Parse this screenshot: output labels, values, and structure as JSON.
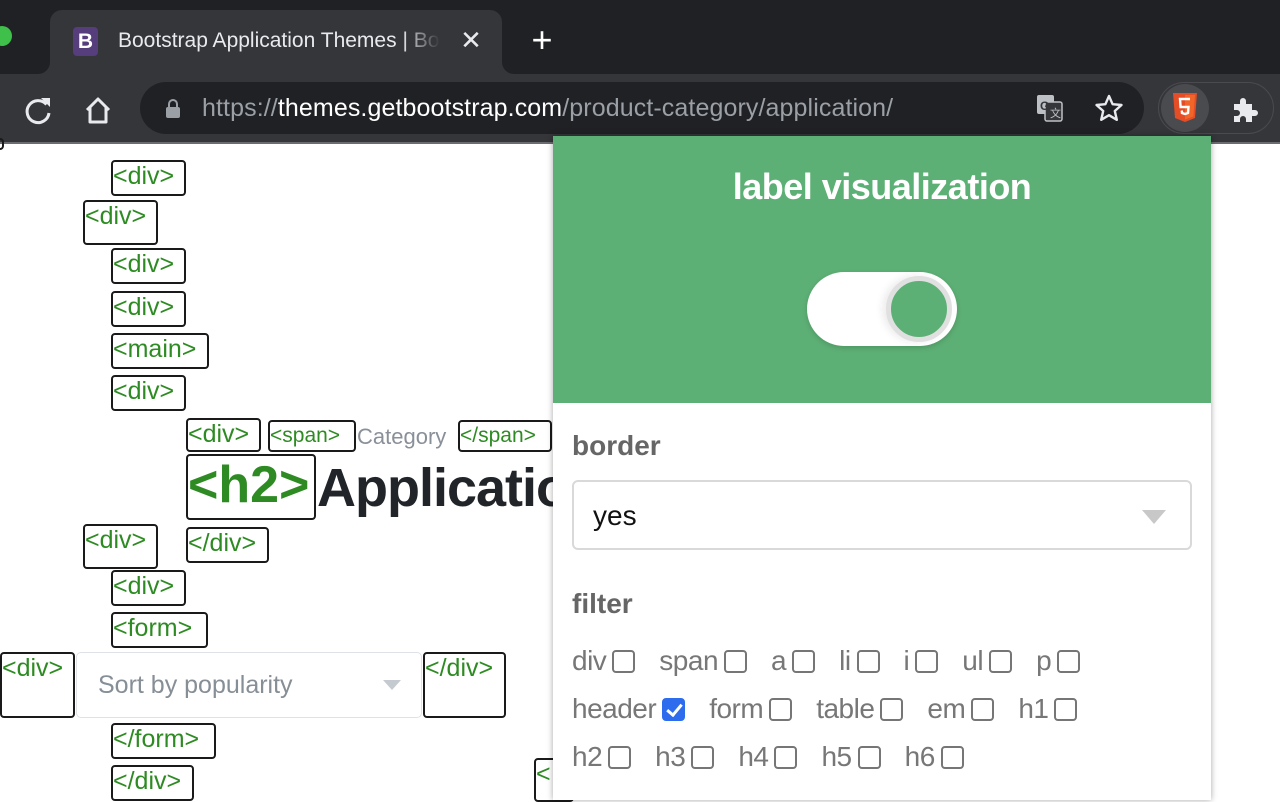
{
  "browser": {
    "tab": {
      "favicon_letter": "B",
      "title": "Bootstrap Application Themes | Bootstrap",
      "close_glyph": "✕"
    },
    "new_tab_glyph": "+",
    "url": {
      "scheme": "https://",
      "host": "themes.getbootstrap.com",
      "path": "/product-category/application/"
    },
    "icons": [
      "reload-icon",
      "home-icon",
      "lock-icon",
      "translate-icon",
      "bookmark-star-icon",
      "html5-extension-icon",
      "extensions-puzzle-icon"
    ]
  },
  "page": {
    "tags": {
      "t1": "<div>",
      "t2": "<div>",
      "t3": "<div>",
      "t4": "<div>",
      "t5": "<main>",
      "t6": "<div>",
      "t7": "<div>",
      "t8": "<span>",
      "t9": "</span>",
      "t10": "<h2>",
      "t11": "<div>",
      "t12": "</div>",
      "t13": "<div>",
      "t14": "<form>",
      "t15": "<div>",
      "t16": "</div>",
      "t17": "</form>",
      "t18": "</div>",
      "t19": "<"
    },
    "category_text": "Category",
    "heading_text": "Applications",
    "sort_select": {
      "value": "Sort by popularity"
    }
  },
  "popup": {
    "title": "label visualization",
    "toggle_on": true,
    "accent_color": "#5db075",
    "border_label": "border",
    "border_value": "yes",
    "filter_label": "filter",
    "filters": [
      {
        "label": "div",
        "checked": false
      },
      {
        "label": "span",
        "checked": false
      },
      {
        "label": "a",
        "checked": false
      },
      {
        "label": "li",
        "checked": false
      },
      {
        "label": "i",
        "checked": false
      },
      {
        "label": "ul",
        "checked": false
      },
      {
        "label": "p",
        "checked": false
      },
      {
        "label": "header",
        "checked": true
      },
      {
        "label": "form",
        "checked": false
      },
      {
        "label": "table",
        "checked": false
      },
      {
        "label": "em",
        "checked": false
      },
      {
        "label": "h1",
        "checked": false
      },
      {
        "label": "h2",
        "checked": false
      },
      {
        "label": "h3",
        "checked": false
      },
      {
        "label": "h4",
        "checked": false
      },
      {
        "label": "h5",
        "checked": false
      },
      {
        "label": "h6",
        "checked": false
      }
    ]
  }
}
